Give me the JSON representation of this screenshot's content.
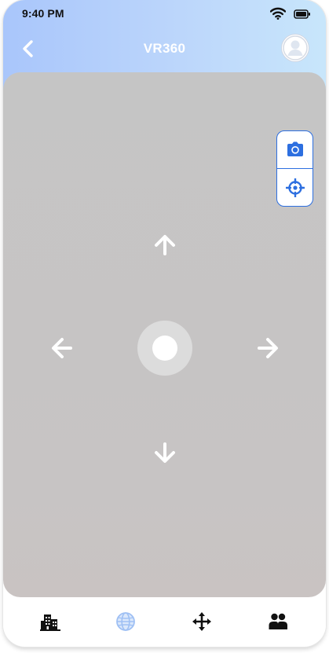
{
  "status_bar": {
    "time": "9:40 PM",
    "icons": [
      "wifi-icon",
      "battery-icon"
    ]
  },
  "header": {
    "title": "VR360",
    "back_icon": "chevron-left-icon",
    "avatar_icon": "user-avatar-icon"
  },
  "viewport": {
    "tools": [
      {
        "name": "camera",
        "icon": "camera-icon"
      },
      {
        "name": "recenter",
        "icon": "crosshair-icon"
      }
    ],
    "controls": [
      "arrow-up-icon",
      "arrow-left-icon",
      "center-button",
      "arrow-right-icon",
      "arrow-down-icon"
    ]
  },
  "bottom_nav": {
    "items": [
      {
        "name": "buildings",
        "icon": "buildings-icon",
        "active": false
      },
      {
        "name": "vr360",
        "icon": "globe-icon",
        "active": true
      },
      {
        "name": "move",
        "icon": "move-arrows-icon",
        "active": false
      },
      {
        "name": "people",
        "icon": "people-icon",
        "active": false
      }
    ]
  },
  "colors": {
    "gradient_start": "#a9c6fb",
    "gradient_end": "#c8e6fb",
    "accent": "#2d6fe0",
    "viewport_gray": "#c5c5c5",
    "control_white": "#ffffff",
    "nav_icon": "#111111",
    "nav_active": "#b8d2f7"
  }
}
